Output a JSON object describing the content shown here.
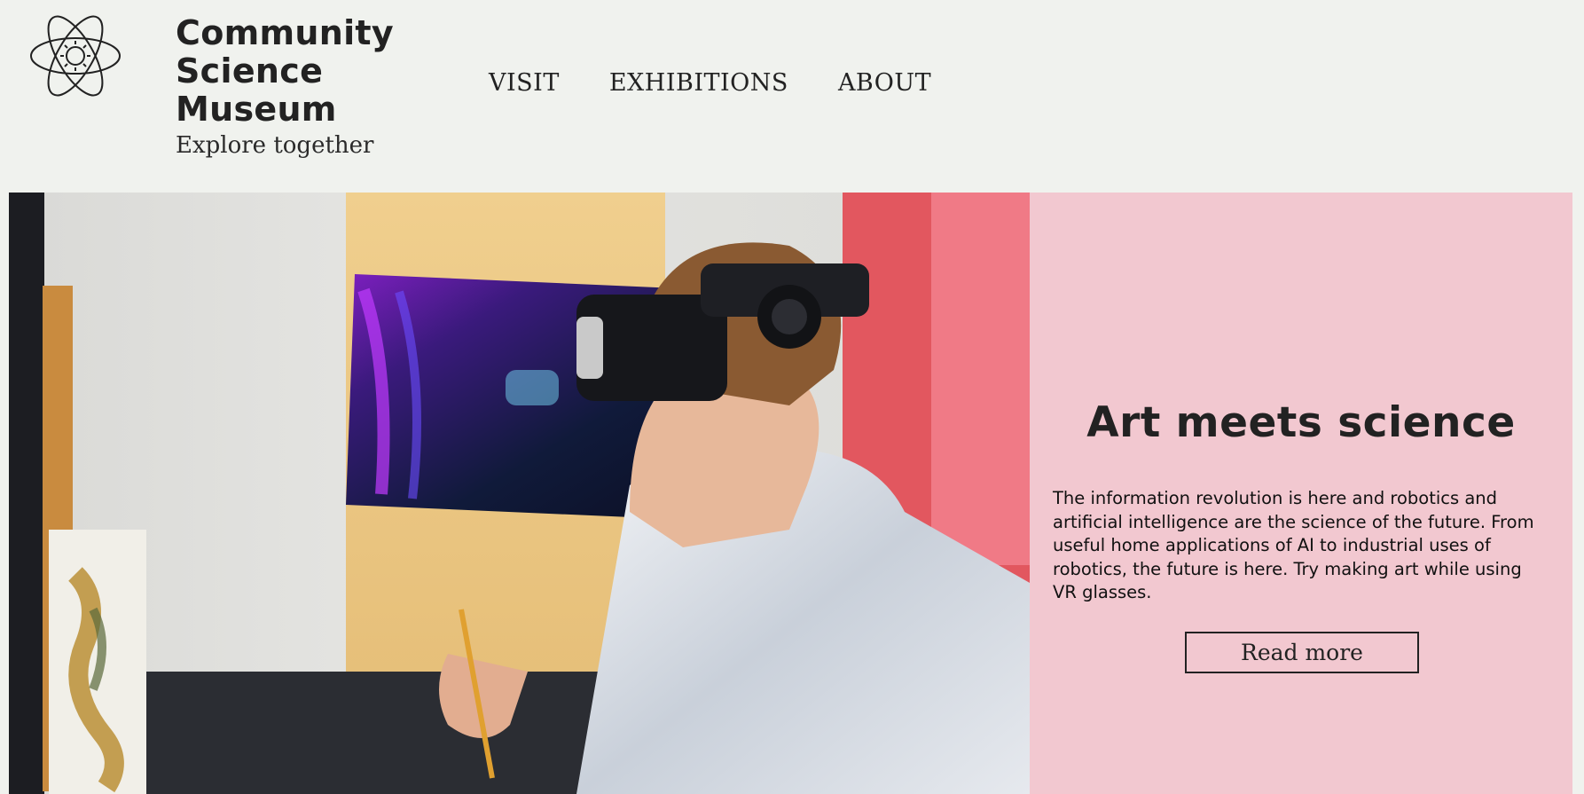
{
  "brand": {
    "title": "Community\nScience\nMuseum",
    "tagline": "Explore together",
    "logo_icon": "atom-icon"
  },
  "nav": {
    "items": [
      {
        "label": "VISIT"
      },
      {
        "label": "EXHIBITIONS"
      },
      {
        "label": "ABOUT"
      }
    ]
  },
  "hero": {
    "image_icon": "person-vr-headset-painting-photo",
    "heading": "Art meets science",
    "body": "The information revolution is here and robotics and artificial intelligence are the science of the future. From useful home applications of AI to industrial uses of robotics, the future is here. Try making art while using VR glasses.",
    "cta_label": "Read more"
  },
  "colors": {
    "page_background": "#f0f2ee",
    "panel_background": "#f2c8d0",
    "text": "#222222"
  }
}
